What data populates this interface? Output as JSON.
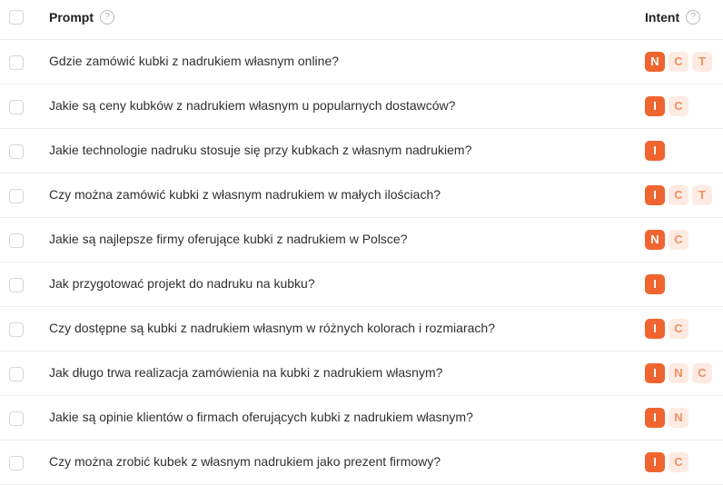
{
  "header": {
    "prompt_label": "Prompt",
    "intent_label": "Intent",
    "help_glyph": "?"
  },
  "colors": {
    "badge_primary_bg": "#f0652f",
    "badge_secondary_bg": "#fdebe3",
    "badge_secondary_text": "#f0905f"
  },
  "rows": [
    {
      "prompt": "Gdzie zamówić kubki z nadrukiem własnym online?",
      "intents": [
        "N",
        "C",
        "T"
      ]
    },
    {
      "prompt": "Jakie są ceny kubków z nadrukiem własnym u popularnych dostawców?",
      "intents": [
        "I",
        "C"
      ]
    },
    {
      "prompt": "Jakie technologie nadruku stosuje się przy kubkach z własnym nadrukiem?",
      "intents": [
        "I"
      ]
    },
    {
      "prompt": "Czy można zamówić kubki z własnym nadrukiem w małych ilościach?",
      "intents": [
        "I",
        "C",
        "T"
      ]
    },
    {
      "prompt": "Jakie są najlepsze firmy oferujące kubki z nadrukiem w Polsce?",
      "intents": [
        "N",
        "C"
      ]
    },
    {
      "prompt": "Jak przygotować projekt do nadruku na kubku?",
      "intents": [
        "I"
      ]
    },
    {
      "prompt": "Czy dostępne są kubki z nadrukiem własnym w różnych kolorach i rozmiarach?",
      "intents": [
        "I",
        "C"
      ]
    },
    {
      "prompt": "Jak długo trwa realizacja zamówienia na kubki z nadrukiem własnym?",
      "intents": [
        "I",
        "N",
        "C"
      ]
    },
    {
      "prompt": "Jakie są opinie klientów o firmach oferujących kubki z nadrukiem własnym?",
      "intents": [
        "I",
        "N"
      ]
    },
    {
      "prompt": "Czy można zrobić kubek z własnym nadrukiem jako prezent firmowy?",
      "intents": [
        "I",
        "C"
      ]
    }
  ]
}
